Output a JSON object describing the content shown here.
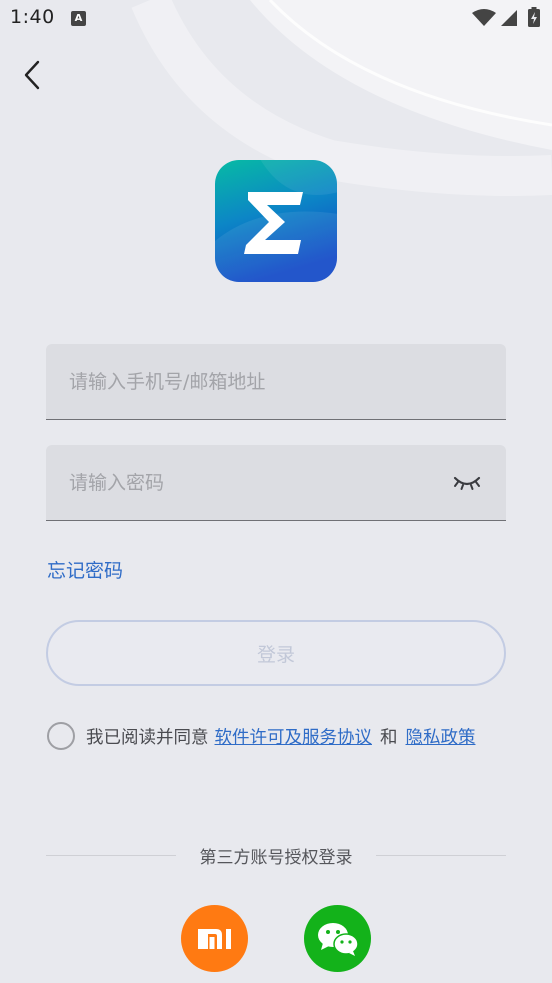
{
  "status_bar": {
    "time": "1:40",
    "notification_icon_letter": "A"
  },
  "logo": {
    "icon": "app-logo-sigma"
  },
  "form": {
    "phone_placeholder": "请输入手机号/邮箱地址",
    "password_placeholder": "请输入密码",
    "forgot_password": "忘记密码",
    "login_button": "登录"
  },
  "agreement": {
    "prefix": "我已阅读并同意",
    "terms_link": "软件许可及服务协议",
    "and": "和",
    "privacy_link": "隐私政策"
  },
  "third_party": {
    "label": "第三方账号授权登录",
    "providers": [
      {
        "name": "xiaomi",
        "icon": "xiaomi-mi-icon",
        "color": "#ff7a12"
      },
      {
        "name": "wechat",
        "icon": "wechat-icon",
        "color": "#13b21a"
      }
    ]
  },
  "colors": {
    "accent": "#2f6cc7",
    "background": "#e8e9ee"
  }
}
